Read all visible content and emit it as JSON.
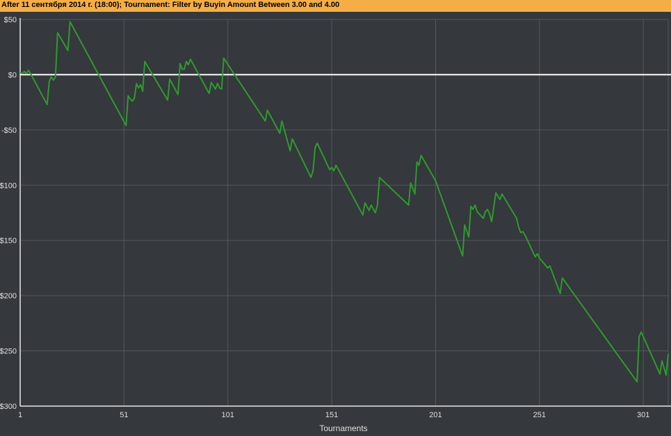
{
  "header": {
    "title": "After 11 сентября 2014 г. (18:00); Tournament: Filter by Buyin Amount  Between 3.00 and 4.00"
  },
  "colors": {
    "background": "#35383c",
    "header": "#f5ae45",
    "line": "#2f9a2f",
    "zero_line": "#ffffff",
    "grid": "#55585c"
  },
  "chart_data": {
    "type": "line",
    "title": "",
    "xlabel": "Tournaments",
    "ylabel": "",
    "xlim": [
      1,
      313
    ],
    "ylim": [
      -300,
      50
    ],
    "grid": true,
    "x_ticks": [
      1,
      51,
      101,
      151,
      201,
      251,
      301
    ],
    "x_tick_labels": [
      "1",
      "51",
      "101",
      "151",
      "201",
      "251",
      "301"
    ],
    "y_ticks": [
      50,
      0,
      -50,
      -100,
      -150,
      -200,
      -250,
      -300
    ],
    "y_tick_labels": [
      "$50",
      "$0",
      "-$50",
      "-$100",
      "-$150",
      "-$200",
      "-$250",
      "-$300"
    ],
    "series": [
      {
        "x": [
          1,
          2,
          3,
          4,
          5,
          6,
          14,
          15,
          16,
          17,
          18,
          19,
          24,
          25,
          52,
          53,
          54,
          55,
          56,
          57,
          58,
          59,
          60,
          61,
          72,
          73,
          77,
          78,
          79,
          80,
          81,
          82,
          83,
          92,
          93,
          95,
          96,
          97,
          98,
          99,
          119,
          120,
          126,
          127,
          131,
          132,
          141,
          142,
          143,
          144,
          145,
          150,
          151,
          152,
          153,
          154,
          166,
          167,
          169,
          170,
          172,
          173,
          174,
          188,
          189,
          191,
          192,
          193,
          194,
          201,
          214,
          215,
          217,
          218,
          219,
          220,
          221,
          224,
          225,
          226,
          227,
          228,
          230,
          231,
          232,
          233,
          240,
          241,
          242,
          243,
          244,
          249,
          250,
          251,
          255,
          256,
          261,
          262,
          298,
          299,
          300,
          309,
          310,
          312,
          313
        ],
        "y": [
          2,
          1,
          3,
          1,
          4,
          1,
          -27,
          -6,
          -2,
          -5,
          -2,
          38,
          22,
          48,
          -46,
          -19,
          -22,
          -24,
          -21,
          -8,
          -12,
          -9,
          -15,
          12,
          -23,
          -4,
          -18,
          10,
          5,
          5,
          12,
          9,
          14,
          -17,
          -7,
          -13,
          -8,
          -12,
          -13,
          15,
          -42,
          -32,
          -53,
          -42,
          -69,
          -58,
          -93,
          -87,
          -66,
          -62,
          -66,
          -86,
          -84,
          -87,
          -82,
          -85,
          -127,
          -116,
          -123,
          -118,
          -125,
          -118,
          -93,
          -118,
          -98,
          -108,
          -79,
          -82,
          -73,
          -96,
          -164,
          -136,
          -147,
          -119,
          -122,
          -118,
          -124,
          -130,
          -124,
          -122,
          -126,
          -133,
          -107,
          -110,
          -113,
          -108,
          -130,
          -138,
          -143,
          -142,
          -145,
          -165,
          -162,
          -166,
          -175,
          -173,
          -198,
          -184,
          -278,
          -237,
          -233,
          -271,
          -259,
          -272,
          -253
        ]
      }
    ]
  }
}
